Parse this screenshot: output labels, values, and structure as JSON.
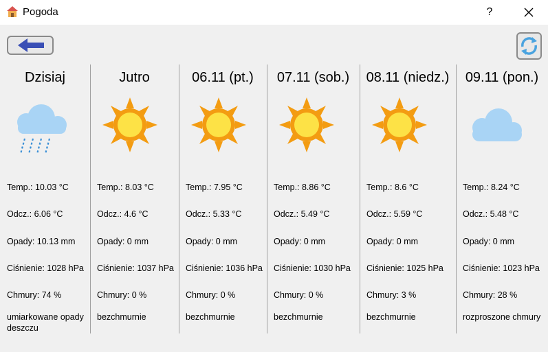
{
  "window": {
    "title": "Pogoda",
    "help_label": "?"
  },
  "days": [
    {
      "day": "Dzisiaj",
      "icon": "rain-cloud-icon",
      "temp": "Temp.: 10.03 °C",
      "feels": "Odcz.: 6.06 °C",
      "precip": "Opady: 10.13 mm",
      "pressure": "Ciśnienie: 1028 hPa",
      "clouds": "Chmury: 74 %",
      "description": "umiarkowane opady deszczu"
    },
    {
      "day": "Jutro",
      "icon": "sun-icon",
      "temp": "Temp.: 8.03 °C",
      "feels": "Odcz.: 4.6 °C",
      "precip": "Opady: 0 mm",
      "pressure": "Ciśnienie: 1037 hPa",
      "clouds": "Chmury: 0 %",
      "description": "bezchmurnie"
    },
    {
      "day": "06.11 (pt.)",
      "icon": "sun-icon",
      "temp": "Temp.: 7.95 °C",
      "feels": "Odcz.: 5.33 °C",
      "precip": "Opady: 0 mm",
      "pressure": "Ciśnienie: 1036 hPa",
      "clouds": "Chmury: 0 %",
      "description": "bezchmurnie"
    },
    {
      "day": "07.11 (sob.)",
      "icon": "sun-icon",
      "temp": "Temp.: 8.86 °C",
      "feels": "Odcz.: 5.49 °C",
      "precip": "Opady: 0 mm",
      "pressure": "Ciśnienie: 1030 hPa",
      "clouds": "Chmury: 0 %",
      "description": "bezchmurnie"
    },
    {
      "day": "08.11 (niedz.)",
      "icon": "sun-icon",
      "temp": "Temp.: 8.6 °C",
      "feels": "Odcz.: 5.59 °C",
      "precip": "Opady: 0 mm",
      "pressure": "Ciśnienie: 1025 hPa",
      "clouds": "Chmury: 3 %",
      "description": "bezchmurnie"
    },
    {
      "day": "09.11 (pon.)",
      "icon": "cloud-icon",
      "temp": "Temp.: 8.24 °C",
      "feels": "Odcz.: 5.48 °C",
      "precip": "Opady: 0 mm",
      "pressure": "Ciśnienie: 1023 hPa",
      "clouds": "Chmury: 28 %",
      "description": "rozproszone chmury"
    }
  ]
}
